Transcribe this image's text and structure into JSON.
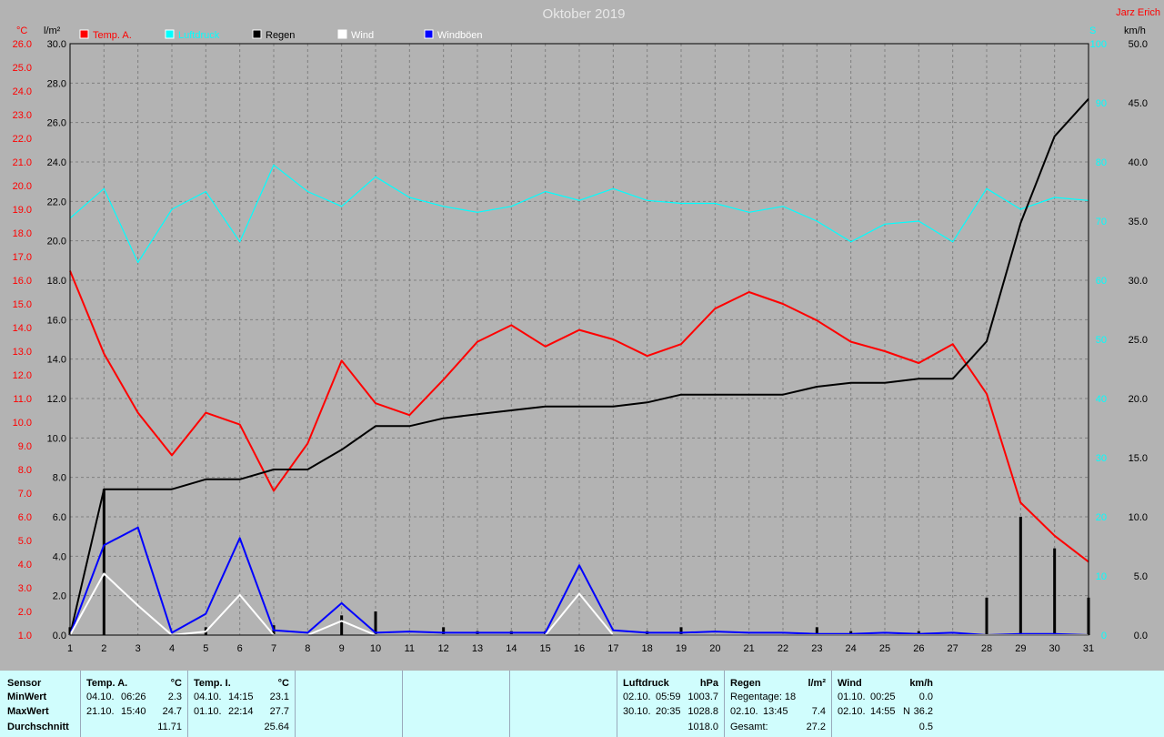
{
  "title": "Oktober 2019",
  "author": "Jarz Erich",
  "colors": {
    "background": "#b3b3b3",
    "temp": "#ff0000",
    "pressure": "#00ffff",
    "rain": "#000000",
    "wind": "#ffffff",
    "gust": "#0000ff",
    "grid": "#808080",
    "table_bg": "#d0fdfd"
  },
  "axes": {
    "temp_unit": "°C",
    "rain_unit": "l/m²",
    "pressure_unit": "S",
    "wind_unit": "km/h",
    "temp_ticks": [
      "1.0",
      "2.0",
      "3.0",
      "4.0",
      "5.0",
      "6.0",
      "7.0",
      "8.0",
      "9.0",
      "10.0",
      "11.0",
      "12.0",
      "13.0",
      "14.0",
      "15.0",
      "16.0",
      "17.0",
      "18.0",
      "19.0",
      "20.0",
      "21.0",
      "22.0",
      "23.0",
      "24.0",
      "25.0",
      "26.0"
    ],
    "rain_ticks": [
      "0.0",
      "2.0",
      "4.0",
      "6.0",
      "8.0",
      "10.0",
      "12.0",
      "14.0",
      "16.0",
      "18.0",
      "20.0",
      "22.0",
      "24.0",
      "26.0",
      "28.0",
      "30.0"
    ],
    "pressure_ticks": [
      "0",
      "10",
      "20",
      "30",
      "40",
      "50",
      "60",
      "70",
      "80",
      "90",
      "100"
    ],
    "wind_ticks": [
      "0.0",
      "5.0",
      "10.0",
      "15.0",
      "20.0",
      "25.0",
      "30.0",
      "35.0",
      "40.0",
      "45.0",
      "50.0"
    ]
  },
  "legend": [
    {
      "label": "Temp. A.",
      "color": "#ff0000",
      "text_color": "#ff0000"
    },
    {
      "label": "Luftdruck",
      "color": "#00ffff",
      "text_color": "#00ffff"
    },
    {
      "label": "Regen",
      "color": "#000000",
      "text_color": "#000000"
    },
    {
      "label": "Wind",
      "color": "#ffffff",
      "text_color": "#ffffff"
    },
    {
      "label": "Windböen",
      "color": "#0000ff",
      "text_color": "#ffffff"
    }
  ],
  "chart_data": {
    "type": "line",
    "title": "Oktober 2019",
    "x": [
      1,
      2,
      3,
      4,
      5,
      6,
      7,
      8,
      9,
      10,
      11,
      12,
      13,
      14,
      15,
      16,
      17,
      18,
      19,
      20,
      21,
      22,
      23,
      24,
      25,
      26,
      27,
      28,
      29,
      30,
      31
    ],
    "xlim": [
      1,
      31
    ],
    "grid": true,
    "series": [
      {
        "name": "Temp. A.",
        "axis": "temp",
        "unit": "°C",
        "ylim": [
          1,
          26
        ],
        "values": [
          16.4,
          12.9,
          10.4,
          8.6,
          10.4,
          9.9,
          7.1,
          9.1,
          12.6,
          10.8,
          10.3,
          11.8,
          13.4,
          14.1,
          13.2,
          13.9,
          13.5,
          12.8,
          13.3,
          14.8,
          15.5,
          15.0,
          14.3,
          13.4,
          13.0,
          12.5,
          13.3,
          11.2,
          6.6,
          5.2,
          4.1
        ]
      },
      {
        "name": "Luftdruck",
        "axis": "pressure",
        "unit": "S",
        "ylim": [
          0,
          100
        ],
        "values": [
          70.5,
          75.5,
          63.0,
          72.0,
          75.0,
          66.5,
          79.5,
          75.0,
          72.5,
          77.5,
          74.0,
          72.5,
          71.5,
          72.5,
          75.0,
          73.5,
          75.5,
          73.5,
          73.0,
          73.0,
          71.5,
          72.5,
          70.0,
          66.5,
          69.5,
          70.0,
          66.5,
          75.5,
          72.0,
          74.0,
          73.5
        ]
      },
      {
        "name": "Regen",
        "axis": "rain",
        "unit": "l/m²",
        "ylim": [
          0,
          30
        ],
        "values": [
          0.0,
          7.4,
          7.4,
          7.4,
          7.9,
          7.9,
          8.4,
          8.4,
          9.4,
          10.6,
          10.6,
          11.0,
          11.2,
          11.4,
          11.6,
          11.6,
          11.6,
          11.8,
          12.2,
          12.2,
          12.2,
          12.2,
          12.6,
          12.8,
          12.8,
          13.0,
          13.0,
          14.9,
          20.9,
          25.3,
          27.2
        ]
      },
      {
        "name": "Wind",
        "axis": "wind",
        "unit": "km/h",
        "ylim": [
          0,
          50
        ],
        "values": [
          0.0,
          5.2,
          2.5,
          0.0,
          0.3,
          3.4,
          0.0,
          0.0,
          1.2,
          0.0,
          0.0,
          0.0,
          0.0,
          0.0,
          0.0,
          3.5,
          0.0,
          0.0,
          0.0,
          0.0,
          0.0,
          0.0,
          0.0,
          0.0,
          0.0,
          0.0,
          0.0,
          0.0,
          0.0,
          0.0,
          0.0
        ]
      },
      {
        "name": "Windböen",
        "axis": "wind",
        "unit": "km/h",
        "ylim": [
          0,
          50
        ],
        "values": [
          0.0,
          7.6,
          9.1,
          0.2,
          1.8,
          8.2,
          0.4,
          0.2,
          2.7,
          0.2,
          0.3,
          0.2,
          0.2,
          0.2,
          0.2,
          5.9,
          0.4,
          0.2,
          0.2,
          0.3,
          0.2,
          0.2,
          0.1,
          0.1,
          0.2,
          0.1,
          0.2,
          0.0,
          0.1,
          0.1,
          0.0
        ]
      },
      {
        "name": "Regen (Tag)",
        "axis": "rain",
        "unit": "l/m²",
        "style": "bars",
        "values": [
          0.4,
          7.4,
          0,
          0,
          0.4,
          0,
          0.5,
          0,
          1.0,
          1.2,
          0,
          0.4,
          0.2,
          0.2,
          0.2,
          0,
          0,
          0.2,
          0.4,
          0,
          0,
          0,
          0.4,
          0.2,
          0,
          0.2,
          0,
          1.9,
          6.0,
          4.4,
          1.9
        ]
      }
    ]
  },
  "table": {
    "row_labels": [
      "Sensor",
      "MinWert",
      "MaxWert",
      "Durchschnitt"
    ],
    "temp_a": {
      "title": "Temp. A.",
      "unit": "°C",
      "min_date": "04.10.",
      "min_time": "06:26",
      "min_val": "2.3",
      "max_date": "21.10.",
      "max_time": "15:40",
      "max_val": "24.7",
      "avg": "11.71"
    },
    "temp_i": {
      "title": "Temp. I.",
      "unit": "°C",
      "min_date": "04.10.",
      "min_time": "14:15",
      "min_val": "23.1",
      "max_date": "01.10.",
      "max_time": "22:14",
      "max_val": "27.7",
      "avg": "25.64"
    },
    "pressure": {
      "title": "Luftdruck",
      "unit": "hPa",
      "min_date": "02.10.",
      "min_time": "05:59",
      "min_val": "1003.7",
      "max_date": "30.10.",
      "max_time": "20:35",
      "max_val": "1028.8",
      "avg": "1018.0"
    },
    "rain": {
      "title": "Regen",
      "unit": "l/m²",
      "days_label": "Regentage: 18",
      "max_date": "02.10.",
      "max_time": "13:45",
      "max_val": "7.4",
      "total_label": "Gesamt:",
      "total": "27.2"
    },
    "wind": {
      "title": "Wind",
      "unit": "km/h",
      "min_date": "01.10.",
      "min_time": "00:25",
      "min_val": "0.0",
      "max_date": "02.10.",
      "max_time": "14:55",
      "max_dir": "N",
      "max_val": "36.2",
      "avg": "0.5"
    }
  }
}
